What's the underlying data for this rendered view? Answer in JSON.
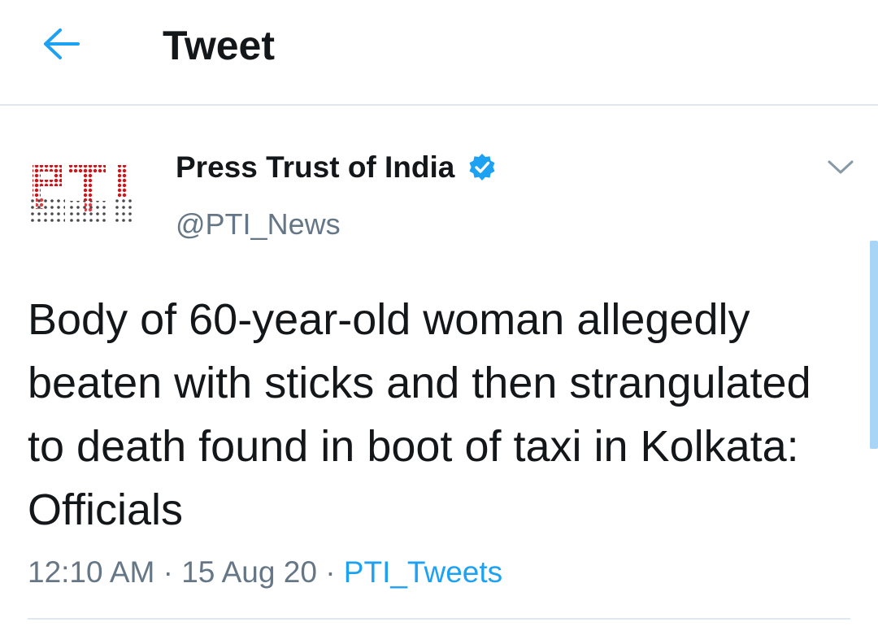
{
  "header": {
    "title": "Tweet",
    "back_icon": "arrow-left-icon",
    "accent_color": "#1da1f2"
  },
  "tweet": {
    "author": {
      "display_name": "Press Trust of India",
      "handle": "@PTI_News",
      "verified": true,
      "avatar_logo_text": "PTI",
      "verified_icon": "verified-badge-icon"
    },
    "text": "Body of 60-year-old woman allegedly beaten with sticks and then strangulated to death found in boot of taxi in Kolkata: Officials",
    "time": "12:10 AM",
    "date": "15 Aug 20",
    "separator": "·",
    "source": "PTI_Tweets",
    "menu_icon": "chevron-down-icon"
  },
  "colors": {
    "text_primary": "#14171a",
    "text_secondary": "#657786",
    "link": "#1da1f2",
    "divider": "#e1e8ed",
    "logo_red": "#d0141a"
  }
}
